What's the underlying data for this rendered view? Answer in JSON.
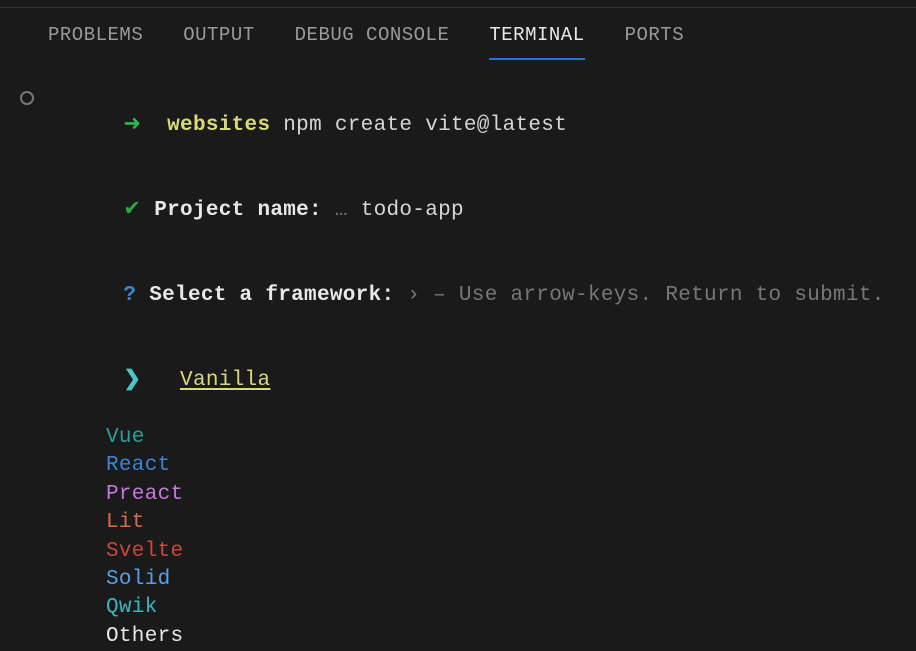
{
  "tabs": {
    "problems": "PROBLEMS",
    "output": "OUTPUT",
    "debug_console": "DEBUG CONSOLE",
    "terminal": "TERMINAL",
    "ports": "PORTS"
  },
  "terminal": {
    "prompt_arrow": "➜",
    "cwd": "websites",
    "command": "npm create vite@latest",
    "project_line_check": "✔",
    "project_line_label": "Project name:",
    "project_line_sep": "…",
    "project_name": "todo-app",
    "q_mark": "?",
    "select_label": "Select a framework:",
    "select_chevron": "›",
    "select_hint": "– Use arrow-keys. Return to submit.",
    "cursor": "❯",
    "options": {
      "vanilla": "Vanilla",
      "vue": "Vue",
      "react": "React",
      "preact": "Preact",
      "lit": "Lit",
      "svelte": "Svelte",
      "solid": "Solid",
      "qwik": "Qwik",
      "others": "Others"
    }
  }
}
